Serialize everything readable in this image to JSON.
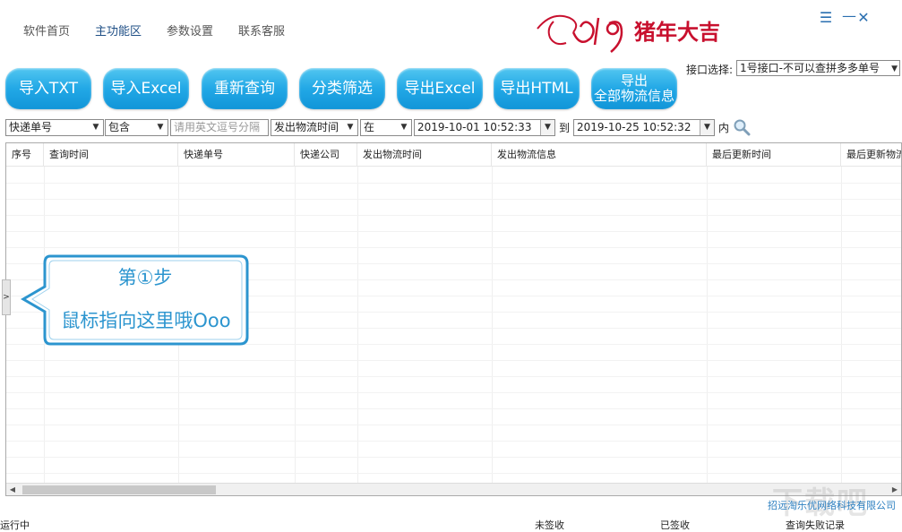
{
  "nav": {
    "items": [
      "软件首页",
      "主功能区",
      "参数设置",
      "联系客服"
    ],
    "active_index": 1,
    "logo_text": "2019猪年大吉",
    "menu_glyph": "☰",
    "minimize_glyph": "—",
    "close_glyph": "✕"
  },
  "toolbar": {
    "buttons": [
      {
        "label": "导入TXT"
      },
      {
        "label": "导入Excel"
      },
      {
        "label": "重新查询"
      },
      {
        "label": "分类筛选"
      },
      {
        "label": "导出Excel"
      },
      {
        "label": "导出HTML"
      },
      {
        "line1": "导出",
        "line2": "全部物流信息"
      }
    ],
    "port_label": "接口选择:",
    "port_value": "1号接口-不可以查拼多多单号"
  },
  "filter": {
    "field": "快递单号",
    "match": "包含",
    "input_placeholder": "请用英文逗号分隔",
    "time_field": "发出物流时间",
    "relation": "在",
    "start": "2019-10-01 10:52:33",
    "to_label": "到",
    "end": "2019-10-25 10:52:32",
    "within_label": "内"
  },
  "table": {
    "columns": [
      "序号",
      "查询时间",
      "快递单号",
      "快递公司",
      "发出物流时间",
      "发出物流信息",
      "最后更新时间",
      "最后更新物流信息"
    ],
    "rows": []
  },
  "callout": {
    "line1": "第①步",
    "line2": "鼠标指向这里哦Ooo"
  },
  "footer": {
    "company_link": "招远淘乐优网络科技有限公司",
    "watermark": "下载吧",
    "status_running": "运行中",
    "unsigned": "未签收",
    "signed": "已签收",
    "failed": "查询失败记录"
  },
  "colors": {
    "accent": "#22a8e6",
    "nav_active": "#1f4f86",
    "callout": "#2c95cf",
    "logo_red": "#c8102e"
  }
}
